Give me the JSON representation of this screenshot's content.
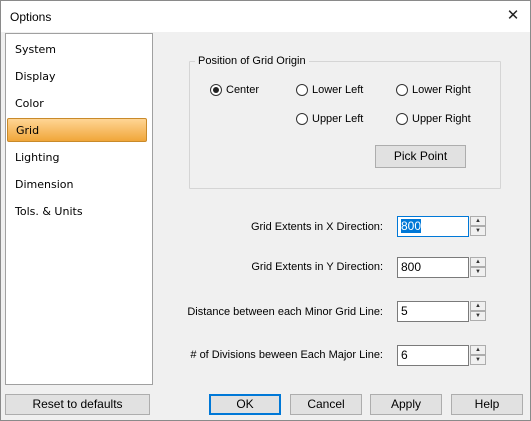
{
  "window": {
    "title": "Options",
    "close_glyph": "✕"
  },
  "sidebar": {
    "items": [
      "System",
      "Display",
      "Color",
      "Grid",
      "Lighting",
      "Dimension",
      "Tols. & Units"
    ],
    "selected": "Grid"
  },
  "origin_group": {
    "label": "Position of Grid Origin",
    "options": {
      "center": "Center",
      "lower_left": "Lower Left",
      "lower_right": "Lower Right",
      "upper_left": "Upper Left",
      "upper_right": "Upper Right"
    },
    "selected": "Center",
    "pick_point": "Pick Point"
  },
  "fields": {
    "x_label": "Grid Extents in X Direction:",
    "x_value": "800",
    "y_label": "Grid Extents in Y Direction:",
    "y_value": "800",
    "minor_label": "Distance between each Minor Grid Line:",
    "minor_value": "5",
    "major_label": "# of Divisions beween Each Major Line:",
    "major_value": "6"
  },
  "buttons": {
    "reset": "Reset to defaults",
    "ok": "OK",
    "cancel": "Cancel",
    "apply": "Apply",
    "help": "Help"
  },
  "colors": {
    "selection_gradient_top": "#ffd595",
    "selection_gradient_bottom": "#f0a63a",
    "focus": "#0078d7"
  }
}
